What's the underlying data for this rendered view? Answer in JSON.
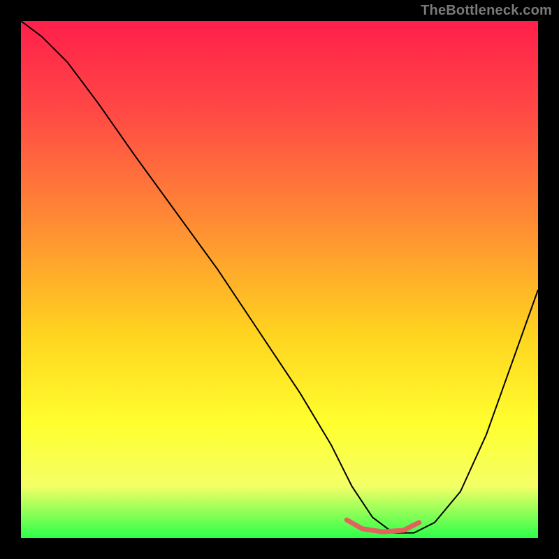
{
  "watermark": "TheBottleneck.com",
  "chart_data": {
    "type": "line",
    "title": "",
    "xlabel": "",
    "ylabel": "",
    "xlim": [
      0,
      100
    ],
    "ylim": [
      0,
      100
    ],
    "grid": false,
    "legend": false,
    "gradient_stops": [
      {
        "offset": 0,
        "color": "#ff1f4b"
      },
      {
        "offset": 18,
        "color": "#ff4a45"
      },
      {
        "offset": 40,
        "color": "#ff8f33"
      },
      {
        "offset": 60,
        "color": "#ffd21f"
      },
      {
        "offset": 78,
        "color": "#ffff2e"
      },
      {
        "offset": 90,
        "color": "#f4ff66"
      },
      {
        "offset": 100,
        "color": "#2bff4a"
      }
    ],
    "series": [
      {
        "name": "bottleneck-curve",
        "color": "#000000",
        "width": 2,
        "x": [
          0,
          4,
          9,
          15,
          22,
          30,
          38,
          46,
          54,
          60,
          64,
          68,
          72,
          76,
          80,
          85,
          90,
          95,
          100
        ],
        "y": [
          100,
          97,
          92,
          84,
          74,
          63,
          52,
          40,
          28,
          18,
          10,
          4,
          1,
          1,
          3,
          9,
          20,
          34,
          48
        ]
      },
      {
        "name": "optimal-region",
        "color": "#e2635e",
        "width": 7,
        "cap": "round",
        "x": [
          63,
          66,
          70,
          74,
          77
        ],
        "y": [
          3.5,
          1.8,
          1.2,
          1.5,
          3.0
        ]
      }
    ]
  }
}
